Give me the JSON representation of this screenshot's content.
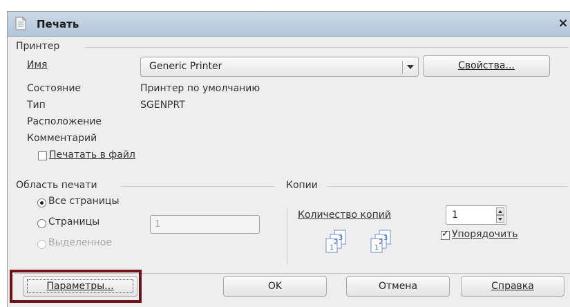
{
  "window": {
    "title": "Печать",
    "close_glyph": "×"
  },
  "printer": {
    "group_title": "Принтер",
    "name_label": "Имя",
    "name_value": "Generic Printer",
    "properties_button": "Свойства...",
    "status_label": "Состояние",
    "status_value": "Принтер по умолчанию",
    "type_label": "Тип",
    "type_value": "SGENPRT",
    "location_label": "Расположение",
    "comment_label": "Комментарий",
    "print_to_file_label": "Печатать в файл",
    "print_to_file_checked": false
  },
  "print_range": {
    "group_title": "Область печати",
    "all_pages_label": "Все страницы",
    "pages_label": "Страницы",
    "pages_value": "1",
    "selection_label": "Выделенное",
    "selected": "all_pages"
  },
  "copies": {
    "group_title": "Копии",
    "count_label": "Количество копий",
    "count_value": "1",
    "collate_label": "Упорядочить",
    "collate_checked": true,
    "page_icon_numbers": [
      "1",
      "2",
      "3"
    ]
  },
  "footer": {
    "options_button": "Параметры...",
    "ok_button": "OK",
    "cancel_button": "Отмена",
    "help_button": "Справка"
  },
  "colors": {
    "titlebar": "#b3c6d9",
    "dialog_bg": "#eeeeee",
    "highlight_border": "#6b1419",
    "collate_icon_blue": "#3d6cb8"
  },
  "icons": [
    "print-dialog-icon",
    "close-icon",
    "collate-pages-icon"
  ]
}
